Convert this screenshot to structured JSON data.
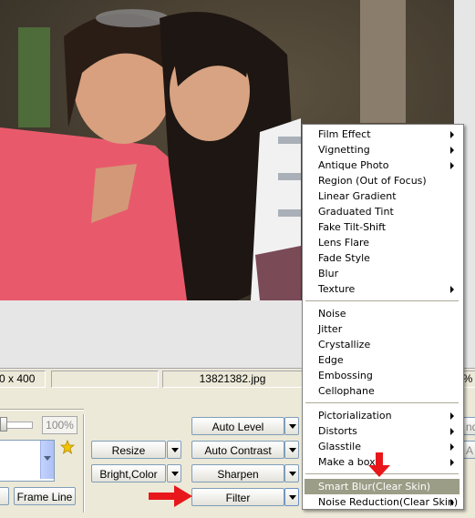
{
  "status": {
    "dimensions": "0 x 400",
    "filename": "13821382.jpg",
    "zoom_right": "0%"
  },
  "zoom": {
    "value": "100%"
  },
  "buttons": {
    "resize": "Resize",
    "bright_color": "Bright,Color",
    "auto_level": "Auto Level",
    "auto_contrast": "Auto Contrast",
    "sharpen": "Sharpen",
    "filter": "Filter",
    "frame_line": "Frame Line",
    "right_partial_1": "nd",
    "right_partial_2": "A"
  },
  "menu": {
    "groups": [
      [
        {
          "label": "Film Effect",
          "submenu": true
        },
        {
          "label": "Vignetting",
          "submenu": true
        },
        {
          "label": "Antique Photo",
          "submenu": true
        },
        {
          "label": "Region (Out of Focus)",
          "submenu": false
        },
        {
          "label": "Linear Gradient",
          "submenu": false
        },
        {
          "label": "Graduated Tint",
          "submenu": false
        },
        {
          "label": "Fake Tilt-Shift",
          "submenu": false
        },
        {
          "label": "Lens Flare",
          "submenu": false
        },
        {
          "label": "Fade Style",
          "submenu": false
        },
        {
          "label": "Blur",
          "submenu": false
        },
        {
          "label": "Texture",
          "submenu": true
        }
      ],
      [
        {
          "label": "Noise",
          "submenu": false
        },
        {
          "label": "Jitter",
          "submenu": false
        },
        {
          "label": "Crystallize",
          "submenu": false
        },
        {
          "label": "Edge",
          "submenu": false
        },
        {
          "label": "Embossing",
          "submenu": false
        },
        {
          "label": "Cellophane",
          "submenu": false
        }
      ],
      [
        {
          "label": "Pictorialization",
          "submenu": true
        },
        {
          "label": "Distorts",
          "submenu": true
        },
        {
          "label": "Glasstile",
          "submenu": true
        },
        {
          "label": "Make a box",
          "submenu": true
        }
      ],
      [
        {
          "label": "Smart Blur(Clear Skin)",
          "submenu": false,
          "highlighted": true
        },
        {
          "label": "Noise Reduction(Clear Skin)",
          "submenu": true
        }
      ]
    ]
  },
  "colors": {
    "menu_highlight": "#9b9d86",
    "arrow": "#e8171b",
    "star": "#f2c400"
  }
}
